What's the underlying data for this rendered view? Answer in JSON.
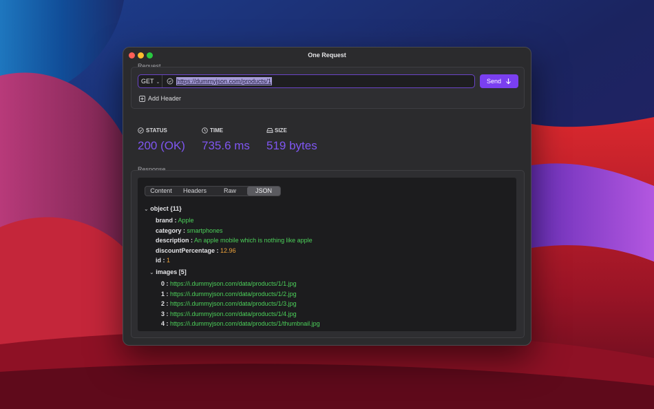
{
  "window": {
    "title": "One Request"
  },
  "request": {
    "section_label": "Request",
    "method": "GET",
    "url": "https://dummyjson.com/products/1",
    "send_label": "Send",
    "add_header_label": "Add Header"
  },
  "stats": {
    "status": {
      "label": "STATUS",
      "value": "200 (OK)"
    },
    "time": {
      "label": "TIME",
      "value": "735.6 ms"
    },
    "size": {
      "label": "SIZE",
      "value": "519 bytes"
    }
  },
  "response": {
    "section_label": "Response",
    "tabs": [
      "Content",
      "Headers",
      "Raw",
      "JSON"
    ],
    "active_tab": "JSON",
    "root_label": "object {11}",
    "fields": [
      {
        "key": "brand :",
        "value": "Apple",
        "type": "string"
      },
      {
        "key": "category :",
        "value": "smartphones",
        "type": "string"
      },
      {
        "key": "description :",
        "value": "An apple mobile which is nothing like apple",
        "type": "string"
      },
      {
        "key": "discountPercentage :",
        "value": "12.96",
        "type": "number"
      },
      {
        "key": "id :",
        "value": "1",
        "type": "number"
      }
    ],
    "images_label": "images [5]",
    "images": [
      {
        "index": "0 :",
        "value": "https://i.dummyjson.com/data/products/1/1.jpg"
      },
      {
        "index": "1 :",
        "value": "https://i.dummyjson.com/data/products/1/2.jpg"
      },
      {
        "index": "2 :",
        "value": "https://i.dummyjson.com/data/products/1/3.jpg"
      },
      {
        "index": "3 :",
        "value": "https://i.dummyjson.com/data/products/1/4.jpg"
      },
      {
        "index": "4 :",
        "value": "https://i.dummyjson.com/data/products/1/thumbnail.jpg"
      }
    ]
  },
  "colors": {
    "accent": "#7a3ff0",
    "stat_value": "#7f56f2",
    "json_string": "#4cd05a",
    "json_number": "#f0a43c"
  }
}
